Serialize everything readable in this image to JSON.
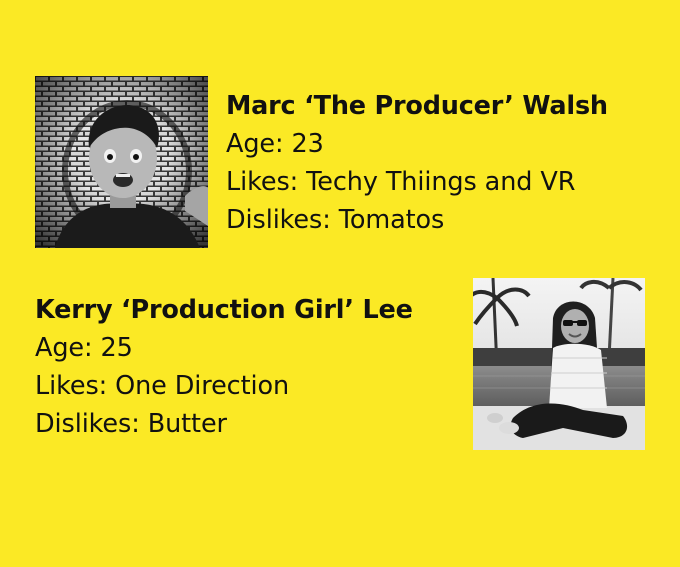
{
  "profiles": [
    {
      "name": "Marc ‘The Producer’ Walsh",
      "age": "Age: 23",
      "likes": "Likes: Techy Thiings and VR",
      "dislikes": "Dislikes: Tomatos",
      "photo": "portrait-photo-icon"
    },
    {
      "name": "Kerry ‘Production Girl’ Lee",
      "age": "Age: 25",
      "likes": "Likes: One Direction",
      "dislikes": "Dislikes: Butter",
      "photo": "portrait-photo-icon"
    }
  ],
  "colors": {
    "background": "#fbe925",
    "text": "#111111"
  }
}
